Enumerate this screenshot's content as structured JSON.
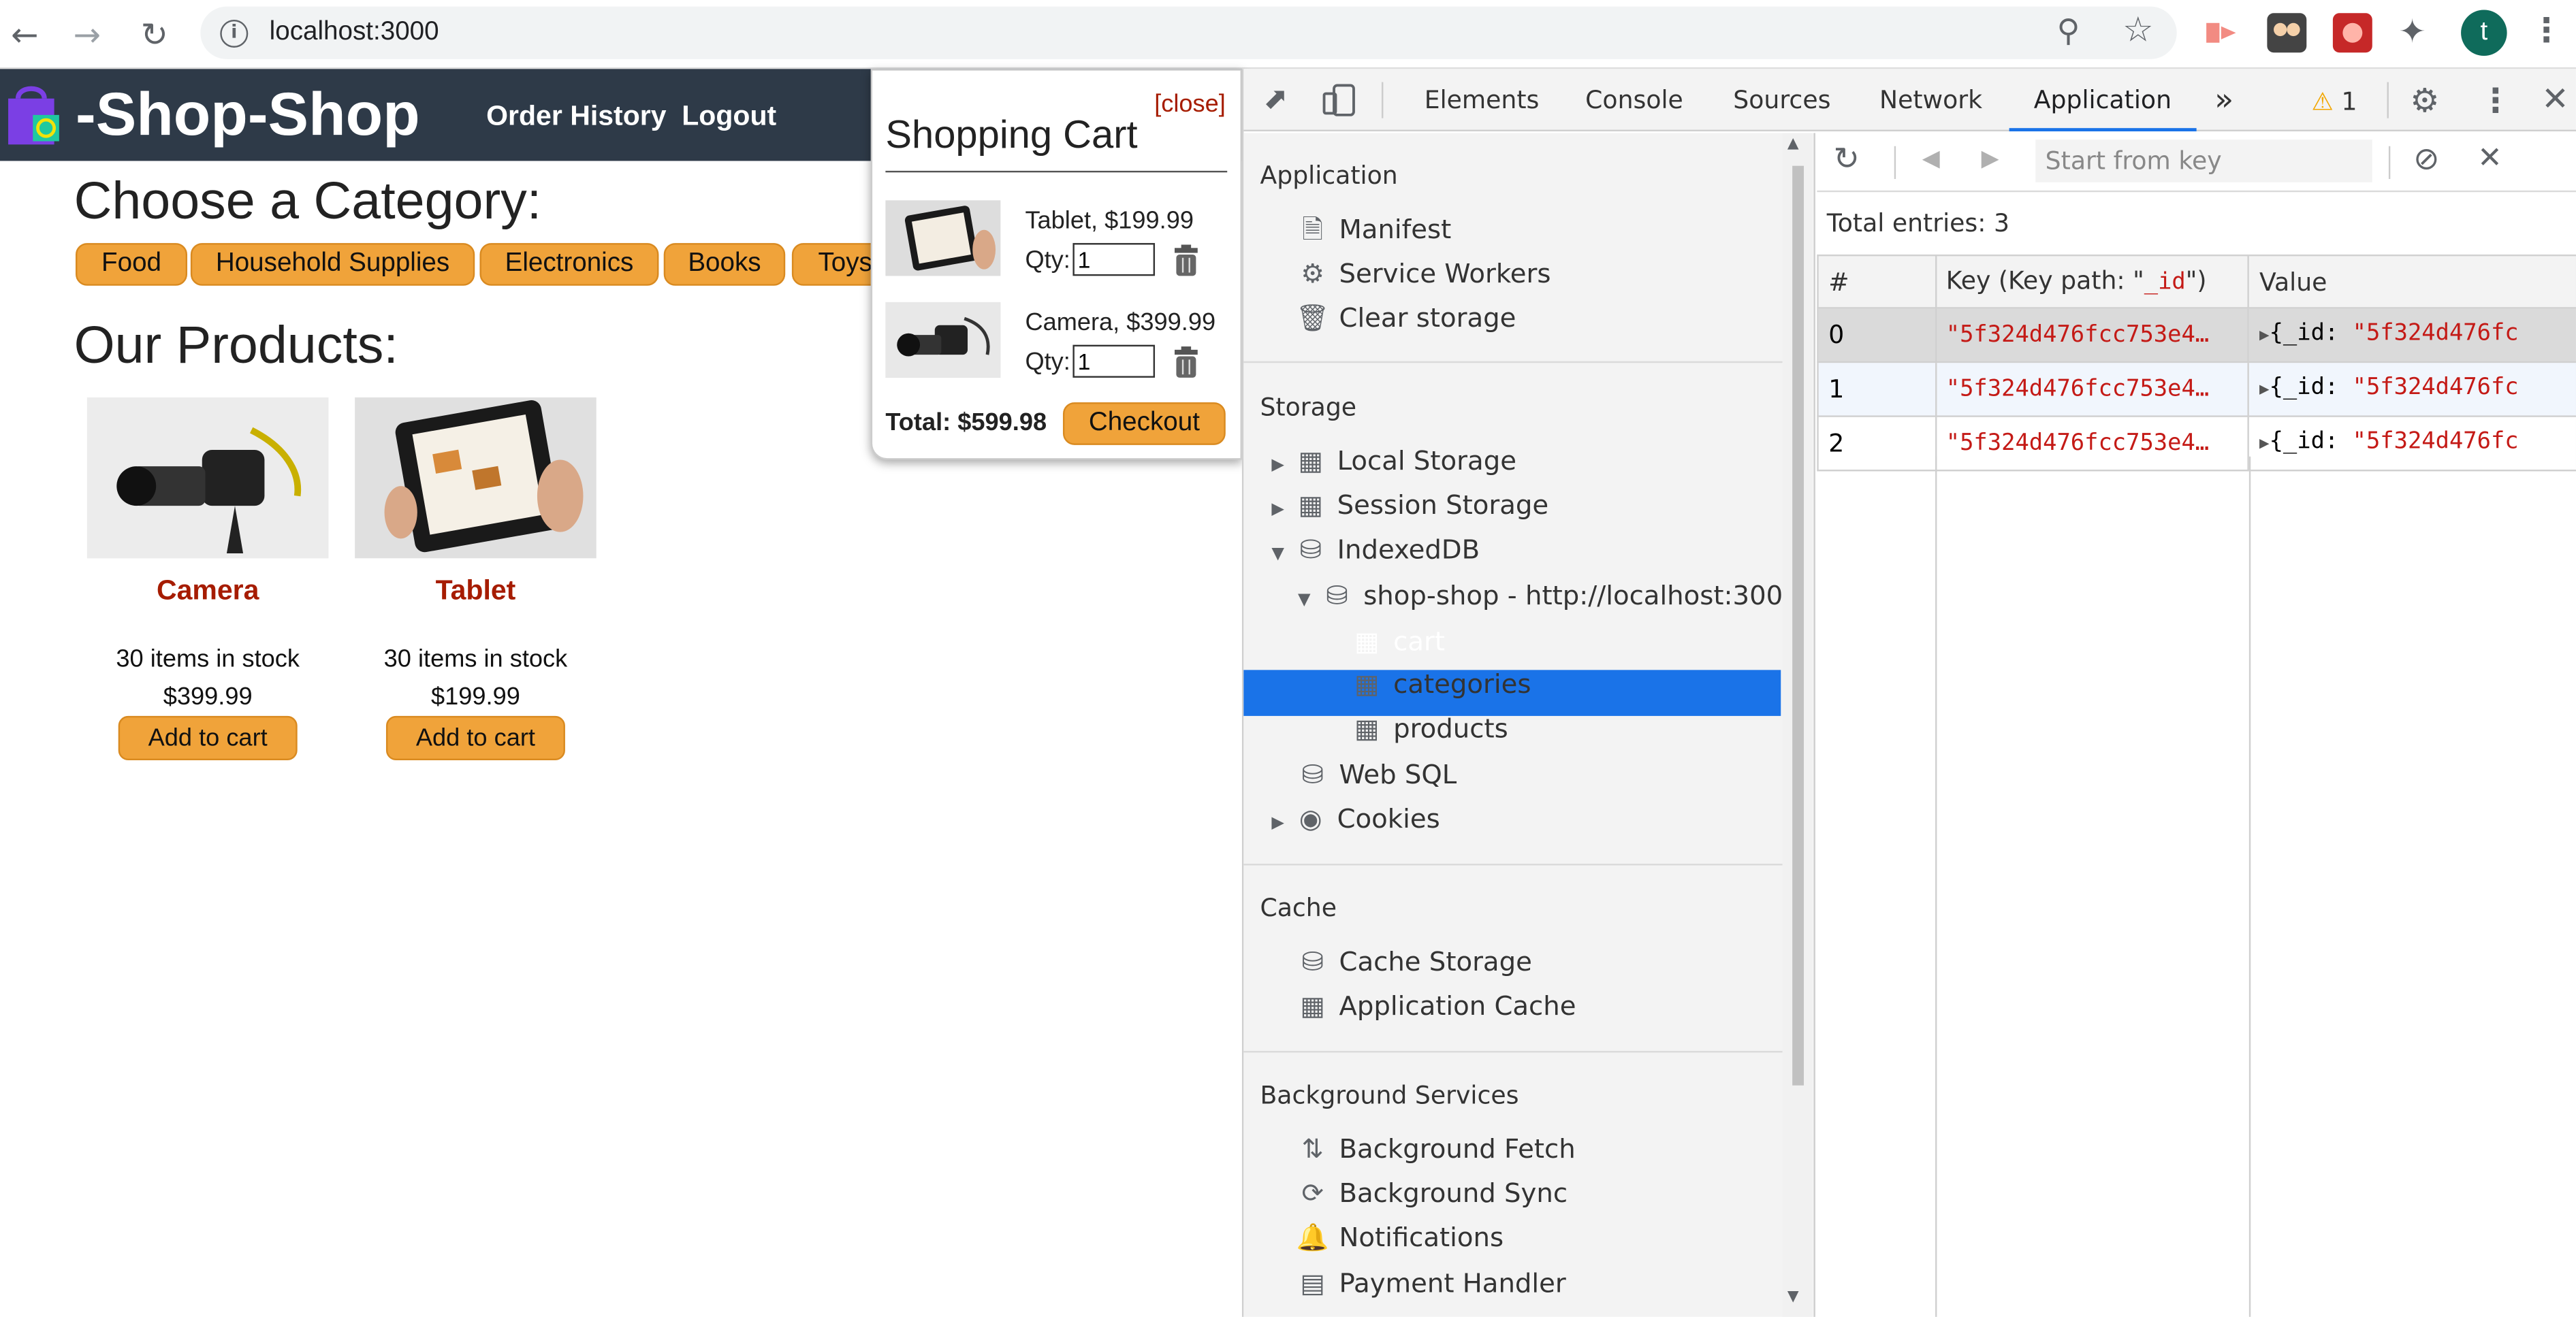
{
  "browser": {
    "url": "localhost:3000",
    "profile_initial": "t",
    "icons": [
      "back-icon",
      "forward-icon",
      "reload-icon",
      "info-icon",
      "zoom-icon",
      "star-icon",
      "extension-icon",
      "puzzle-icon"
    ]
  },
  "site": {
    "brand": "-Shop-Shop",
    "nav": [
      "Order History",
      "Logout"
    ],
    "category_heading": "Choose a Category:",
    "categories": [
      "Food",
      "Household Supplies",
      "Electronics",
      "Books",
      "Toys"
    ],
    "products_heading": "Our Products:",
    "products": [
      {
        "name": "Camera",
        "stock": "30 items in stock",
        "price": "$399.99",
        "button": "Add to cart"
      },
      {
        "name": "Tablet",
        "stock": "30 items in stock",
        "price": "$199.99",
        "button": "Add to cart"
      }
    ],
    "accent": "#f0a33a",
    "nav_bg": "#2e3a48"
  },
  "cart": {
    "close": "[close]",
    "title": "Shopping Cart",
    "items": [
      {
        "name": "Tablet, $199.99",
        "qty_label": "Qty:",
        "qty": "1"
      },
      {
        "name": "Camera, $399.99",
        "qty_label": "Qty:",
        "qty": "1"
      }
    ],
    "total": "Total: $599.98",
    "checkout": "Checkout"
  },
  "devtools": {
    "tabs": [
      "Elements",
      "Console",
      "Sources",
      "Network",
      "Application"
    ],
    "active_tab": "Application",
    "more": "»",
    "warning_count": "1",
    "sidebar": {
      "application_title": "Application",
      "application_items": [
        "Manifest",
        "Service Workers",
        "Clear storage"
      ],
      "storage_title": "Storage",
      "storage_items": [
        "Local Storage",
        "Session Storage",
        "IndexedDB"
      ],
      "db_name": "shop-shop - http://localhost:3000",
      "stores": [
        "cart",
        "categories",
        "products"
      ],
      "storage_more": [
        "Web SQL",
        "Cookies"
      ],
      "cache_title": "Cache",
      "cache_items": [
        "Cache Storage",
        "Application Cache"
      ],
      "bg_title": "Background Services",
      "bg_items": [
        "Background Fetch",
        "Background Sync",
        "Notifications",
        "Payment Handler"
      ]
    },
    "main": {
      "key_placeholder": "Start from key",
      "total_entries": "Total entries: 3",
      "columns": [
        "#",
        "Key (Key path: \"_id\")",
        "Value"
      ],
      "key_path_label": "Key (Key path: \"",
      "key_path_value": "_id",
      "key_path_end": "\")",
      "rows": [
        {
          "index": "0",
          "key": "\"5f324d476fcc753e4…",
          "value_label": "{_id: ",
          "value": "\"5f324d476fc"
        },
        {
          "index": "1",
          "key": "\"5f324d476fcc753e4…",
          "value_label": "{_id: ",
          "value": "\"5f324d476fc"
        },
        {
          "index": "2",
          "key": "\"5f324d476fcc753e4…",
          "value_label": "{_id: ",
          "value": "\"5f324d476fc"
        }
      ]
    }
  }
}
